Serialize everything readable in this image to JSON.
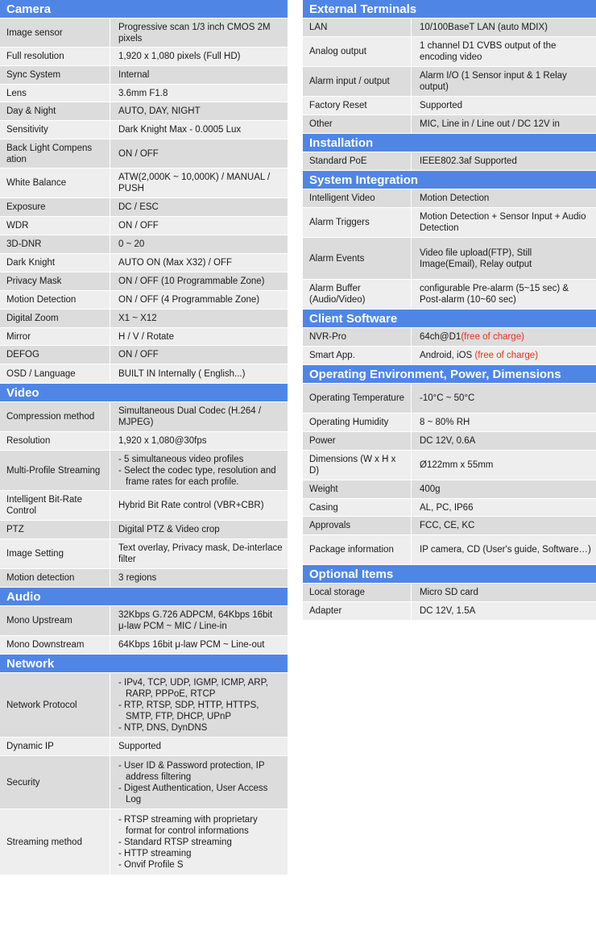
{
  "accent_color": "#4f86e6",
  "left_sections": [
    {
      "id": "camera",
      "title": "Camera",
      "rows": [
        {
          "label": "Image sensor",
          "value": "Progressive scan 1/3 inch CMOS 2M pixels",
          "h": 36
        },
        {
          "label": "Full resolution",
          "value": "1,920 x 1,080 pixels (Full HD)",
          "h": 23
        },
        {
          "label": "Sync System",
          "value": "Internal",
          "h": 23
        },
        {
          "label": "Lens",
          "value": "3.6mm F1.8",
          "h": 22
        },
        {
          "label": "Day & Night",
          "value": "AUTO, DAY, NIGHT",
          "h": 23
        },
        {
          "label": "Sensitivity",
          "value": "Dark Knight Max - 0.0005 Lux",
          "h": 23
        },
        {
          "label": "Back Light Compens ation",
          "value": "ON / OFF",
          "h": 36
        },
        {
          "label": "White Balance",
          "value": "ATW(2,000K ~ 10,000K) / MANUAL / PUSH",
          "h": 37
        },
        {
          "label": "Exposure",
          "value": "DC / ESC",
          "h": 23
        },
        {
          "label": "WDR",
          "value": "ON / OFF",
          "h": 23
        },
        {
          "label": "3D-DNR",
          "value": "0 ~ 20",
          "h": 23
        },
        {
          "label": "Dark Knight",
          "value": "AUTO ON (Max X32) / OFF",
          "h": 23
        },
        {
          "label": "Privacy Mask",
          "value": "ON / OFF (10 Programmable Zone)",
          "h": 23
        },
        {
          "label": "Motion Detection",
          "value": "ON / OFF (4 Programmable Zone)",
          "h": 23
        },
        {
          "label": "Digital Zoom",
          "value": "X1 ~ X12",
          "h": 23
        },
        {
          "label": "Mirror",
          "value": "H / V / Rotate",
          "h": 22
        },
        {
          "label": "DEFOG",
          "value": "ON / OFF",
          "h": 23
        },
        {
          "label": "OSD / Language",
          "value": "BUILT IN Internally ( English...)",
          "h": 24
        }
      ]
    },
    {
      "id": "video",
      "title": "Video",
      "rows": [
        {
          "label": "Compression method",
          "value": "Simultaneous Dual Codec (H.264 / MJPEG)",
          "h": 37
        },
        {
          "label": "Resolution",
          "value": "1,920 x 1,080@30fps",
          "h": 23
        },
        {
          "label": "Multi-Profile Streaming",
          "bullets": [
            "- 5 simultaneous video profiles",
            "- Select the codec type, resolution and frame rates for each profile."
          ],
          "h": 50
        },
        {
          "label": "Intelligent Bit-Rate Control",
          "value": "Hybrid Bit Rate control (VBR+CBR)",
          "h": 37
        },
        {
          "label": "PTZ",
          "value": "Digital PTZ & Video crop",
          "h": 23
        },
        {
          "label": "Image Setting",
          "value": "Text overlay, Privacy mask, De-interlace filter",
          "h": 37
        },
        {
          "label": "Motion detection",
          "value": "3 regions",
          "h": 23
        }
      ]
    },
    {
      "id": "audio",
      "title": "Audio",
      "rows": [
        {
          "label": "Mono Upstream",
          "value": "32Kbps G.726 ADPCM, 64Kbps 16bit μ-law PCM ~ MIC / Line-in",
          "h": 37
        },
        {
          "label": "Mono Downstream",
          "value": "64Kbps 16bit μ-law PCM ~ Line-out",
          "h": 23
        }
      ]
    },
    {
      "id": "network",
      "title": "Network",
      "rows": [
        {
          "label": "Network Protocol",
          "bullets": [
            "- IPv4, TCP, UDP, IGMP, ICMP, ARP, RARP, PPPoE, RTCP",
            "- RTP, RTSP, SDP, HTTP, HTTPS, SMTP, FTP, DHCP, UPnP",
            "- NTP, DNS, DynDNS"
          ],
          "h": 80
        },
        {
          "label": "Dynamic IP",
          "value": "Supported",
          "h": 23
        },
        {
          "label": "Security",
          "bullets": [
            "- User ID & Password protection, IP address filtering",
            "- Digest Authentication, User Access Log"
          ],
          "h": 66
        },
        {
          "label": "Streaming method",
          "bullets": [
            "- RTSP streaming with proprietary format for control informations",
            "- Standard RTSP streaming",
            "- HTTP streaming",
            "- Onvif Profile S"
          ],
          "h": 82
        }
      ]
    }
  ],
  "right_sections": [
    {
      "id": "external-terminals",
      "title": "External Terminals",
      "rows": [
        {
          "label": "LAN",
          "value": "10/100BaseT LAN (auto MDIX)",
          "h": 23
        },
        {
          "label": "Analog output",
          "value": "1 channel D1 CVBS output of the encoding video",
          "h": 37
        },
        {
          "label": "Alarm input / output",
          "value": "Alarm I/O (1 Sensor input & 1 Relay output)",
          "h": 37
        },
        {
          "label": "Factory Reset",
          "value": "Supported",
          "h": 23
        },
        {
          "label": "Other",
          "value": "MIC, Line in / Line out / DC 12V in",
          "h": 23
        }
      ]
    },
    {
      "id": "installation",
      "title": "Installation",
      "rows": [
        {
          "label": "Standard PoE",
          "value": "IEEE802.3af Supported",
          "h": 23
        }
      ]
    },
    {
      "id": "system-integration",
      "title": "System Integration",
      "rows": [
        {
          "label": "Intelligent Video",
          "value": "Motion Detection",
          "h": 23
        },
        {
          "label": "Alarm Triggers",
          "value": "Motion Detection + Sensor Input + Audio Detection",
          "h": 37
        },
        {
          "label": "Alarm Events",
          "value": "Video file upload(FTP), Still Image(Email), Relay output",
          "h": 52
        },
        {
          "label": "Alarm Buffer (Audio/Video)",
          "value": "configurable Pre-alarm (5~15 sec) & Post-alarm (10~60 sec)",
          "h": 37
        }
      ]
    },
    {
      "id": "client-software",
      "title": "Client Software",
      "rows": [
        {
          "label": "NVR-Pro",
          "value": "64ch@D1",
          "note": "(free of charge)",
          "h": 23
        },
        {
          "label": "Smart App.",
          "value": "Android, iOS ",
          "note": "(free of charge)",
          "h": 23
        }
      ]
    },
    {
      "id": "operating-environment",
      "title": "Operating Environment, Power, Dimensions",
      "rows": [
        {
          "label": "Operating Temperature",
          "value": "-10°C ~ 50°C",
          "h": 37
        },
        {
          "label": "Operating Humidity",
          "value": "8 ~ 80% RH",
          "h": 23
        },
        {
          "label": "Power",
          "value": "DC 12V, 0.6A",
          "h": 23
        },
        {
          "label": "Dimensions (W x H x D)",
          "value": "Ø122mm x 55mm",
          "h": 37
        },
        {
          "label": "Weight",
          "value": "400g",
          "h": 23
        },
        {
          "label": "Casing",
          "value": "AL, PC, IP66",
          "h": 22
        },
        {
          "label": "Approvals",
          "value": "FCC, CE, KC",
          "h": 23
        },
        {
          "label": "Package information",
          "value": "IP camera, CD (User's guide, Software…)",
          "h": 37
        }
      ]
    },
    {
      "id": "optional-items",
      "title": "Optional Items",
      "rows": [
        {
          "label": "Local storage",
          "value": "Micro SD card",
          "h": 23
        },
        {
          "label": "Adapter",
          "value": "DC 12V, 1.5A",
          "h": 23
        }
      ]
    }
  ]
}
